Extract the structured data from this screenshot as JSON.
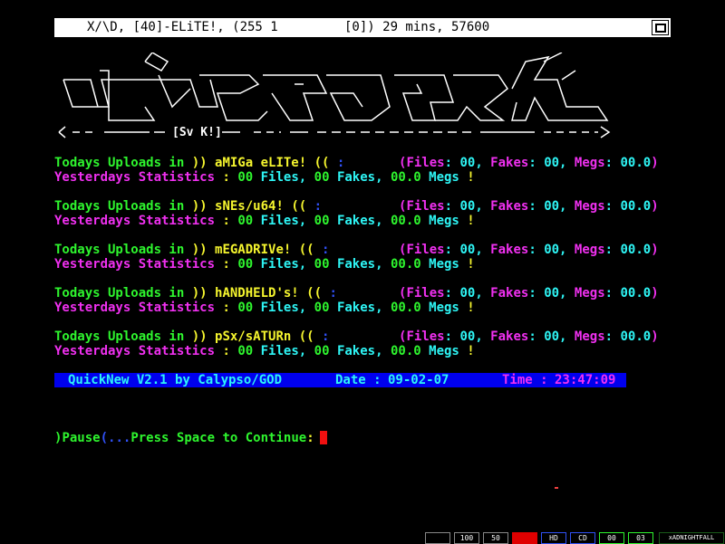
{
  "titlebar": {
    "left": "X/\\D, [40]-ELiTE!, (255 1",
    "right": "[0]) 29 mins, 57600",
    "button_icon": "window-restore-icon"
  },
  "logo": {
    "tag": "[Sv K!]"
  },
  "sections": [
    {
      "today_label": "Todays Uploads in ",
      "open": "))",
      "name": "aMIGa eLITe!",
      "close": "((",
      "colon": ":",
      "stats": {
        "files_label": "Files",
        "files": "00",
        "fakes_label": "Fakes",
        "fakes": "00",
        "megs_label": "Megs",
        "megs": "00.0"
      },
      "yesterday_label": "Yesterdays Statistics",
      "y_colon": ":",
      "y_files": "00",
      "y_files_label": "Files",
      "y_fakes": "00",
      "y_fakes_label": "Fakes",
      "y_megs": "00.0",
      "y_megs_label": "Megs",
      "y_excl": "!"
    },
    {
      "today_label": "Todays Uploads in ",
      "open": "))",
      "name": "sNEs/u64!",
      "close": "((",
      "colon": ":",
      "stats": {
        "files_label": "Files",
        "files": "00",
        "fakes_label": "Fakes",
        "fakes": "00",
        "megs_label": "Megs",
        "megs": "00.0"
      },
      "yesterday_label": "Yesterdays Statistics",
      "y_colon": ":",
      "y_files": "00",
      "y_files_label": "Files",
      "y_fakes": "00",
      "y_fakes_label": "Fakes",
      "y_megs": "00.0",
      "y_megs_label": "Megs",
      "y_excl": "!"
    },
    {
      "today_label": "Todays Uploads in ",
      "open": "))",
      "name": "mEGADRIVe!",
      "close": "((",
      "colon": ":",
      "stats": {
        "files_label": "Files",
        "files": "00",
        "fakes_label": "Fakes",
        "fakes": "00",
        "megs_label": "Megs",
        "megs": "00.0"
      },
      "yesterday_label": "Yesterdays Statistics",
      "y_colon": ":",
      "y_files": "00",
      "y_files_label": "Files",
      "y_fakes": "00",
      "y_fakes_label": "Fakes",
      "y_megs": "00.0",
      "y_megs_label": "Megs",
      "y_excl": "!"
    },
    {
      "today_label": "Todays Uploads in ",
      "open": "))",
      "name": "hANDHELD's!",
      "close": "((",
      "colon": ":",
      "stats": {
        "files_label": "Files",
        "files": "00",
        "fakes_label": "Fakes",
        "fakes": "00",
        "megs_label": "Megs",
        "megs": "00.0"
      },
      "yesterday_label": "Yesterdays Statistics",
      "y_colon": ":",
      "y_files": "00",
      "y_files_label": "Files",
      "y_fakes": "00",
      "y_fakes_label": "Fakes",
      "y_megs": "00.0",
      "y_megs_label": "Megs",
      "y_excl": "!"
    },
    {
      "today_label": "Todays Uploads in ",
      "open": "))",
      "name": "pSx/sATURn",
      "close": "((",
      "colon": ":",
      "stats": {
        "files_label": "Files",
        "files": "00",
        "fakes_label": "Fakes",
        "fakes": "00",
        "megs_label": "Megs",
        "megs": "00.0"
      },
      "yesterday_label": "Yesterdays Statistics",
      "y_colon": ":",
      "y_files": "00",
      "y_files_label": "Files",
      "y_fakes": "00",
      "y_fakes_label": "Fakes",
      "y_megs": "00.0",
      "y_megs_label": "Megs",
      "y_excl": "!"
    }
  ],
  "status": {
    "program": "QuickNew V2.1 by Calypso/GOD",
    "date_label": "Date :",
    "date": "09-02-07",
    "time_label": "Time :",
    "time": "23:47:09"
  },
  "pause": {
    "open": ")",
    "label": "Pause",
    "sep": "(...",
    "prompt": "Press Space to Continue",
    "colon": ":"
  },
  "taskbar": {
    "items": [
      "",
      "100",
      "50",
      "",
      "HD",
      "CD",
      "00",
      "03"
    ],
    "tray": "xADNIGHTFALL"
  },
  "colors": {
    "green": "#2ef52e",
    "yellow": "#f5f52e",
    "magenta": "#f030f0",
    "cyan": "#2ef5f5",
    "blue": "#3050f5",
    "status_bg": "#0000ee"
  }
}
